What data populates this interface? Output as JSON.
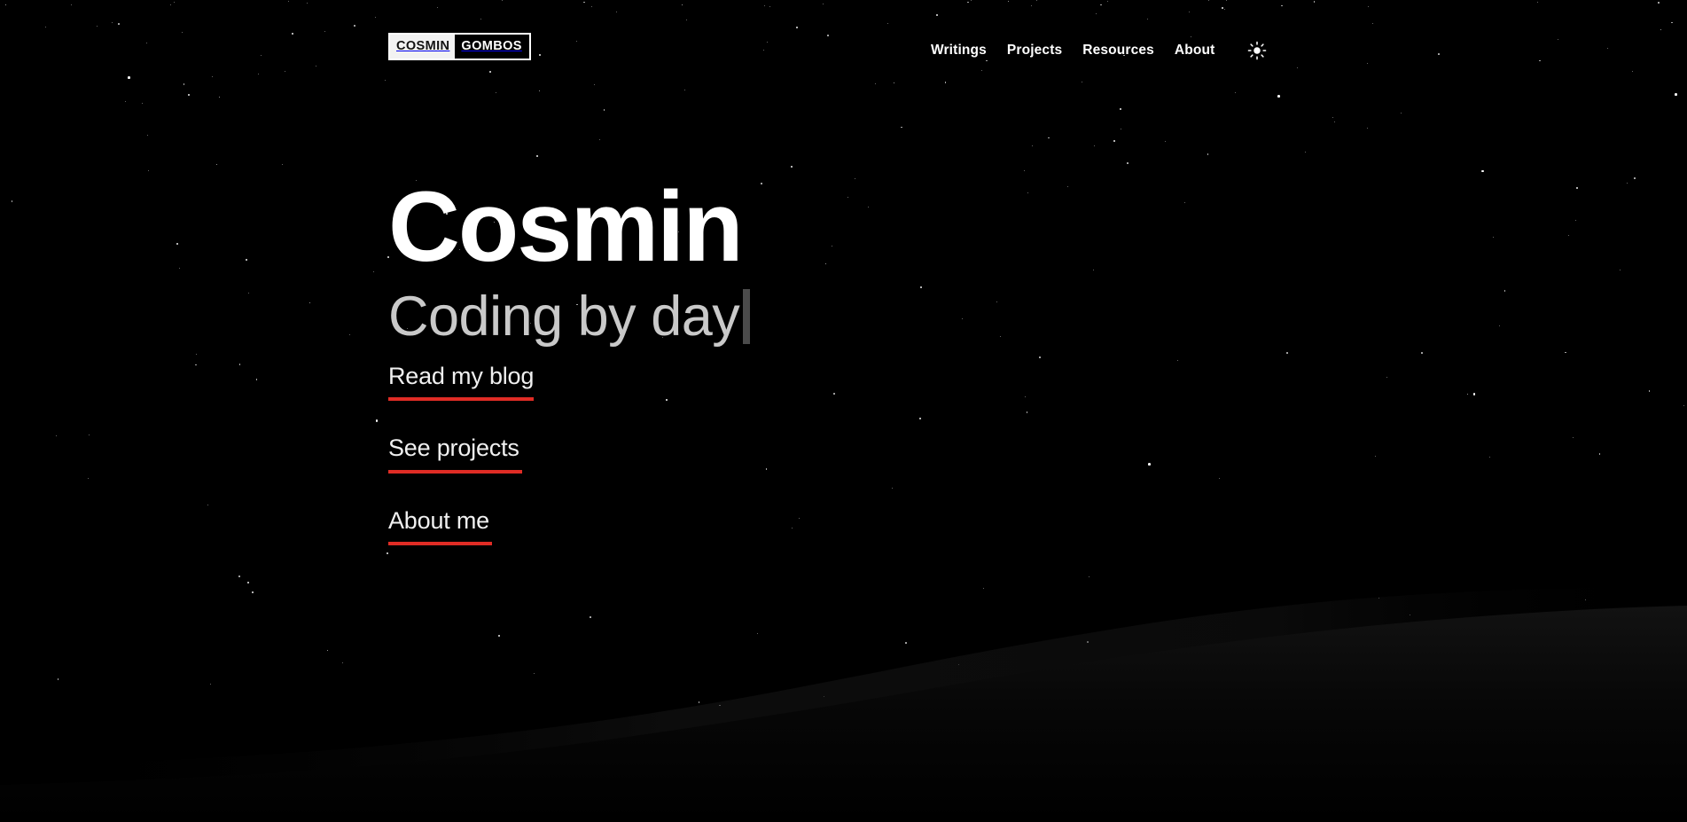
{
  "meta": {
    "background_color": "#000000",
    "accent_color": "#e02c25",
    "text_color": "#ffffff",
    "muted_text_color": "#c9c9c9",
    "cursor_color": "#4b4b4b"
  },
  "header": {
    "logo": {
      "first_word": "COSMIN",
      "last_word": "GOMBOS"
    },
    "nav": {
      "items": [
        {
          "label": "Writings"
        },
        {
          "label": "Projects"
        },
        {
          "label": "Resources"
        },
        {
          "label": "About"
        }
      ],
      "theme_toggle": {
        "icon": "sun-icon",
        "state": "light-mode-toggle"
      }
    }
  },
  "hero": {
    "name": "Cosmin",
    "tagline": "Coding by day",
    "cursor": "|",
    "links": [
      {
        "label": "Read my blog",
        "underline_width": 164
      },
      {
        "label": "See projects",
        "underline_width": 151
      },
      {
        "label": "About me",
        "underline_width": 117
      }
    ]
  },
  "background": {
    "scene": "night-sky-starfield-with-mountain-ridge",
    "star_count": 230,
    "ridge_color": "#0a0a0a"
  }
}
